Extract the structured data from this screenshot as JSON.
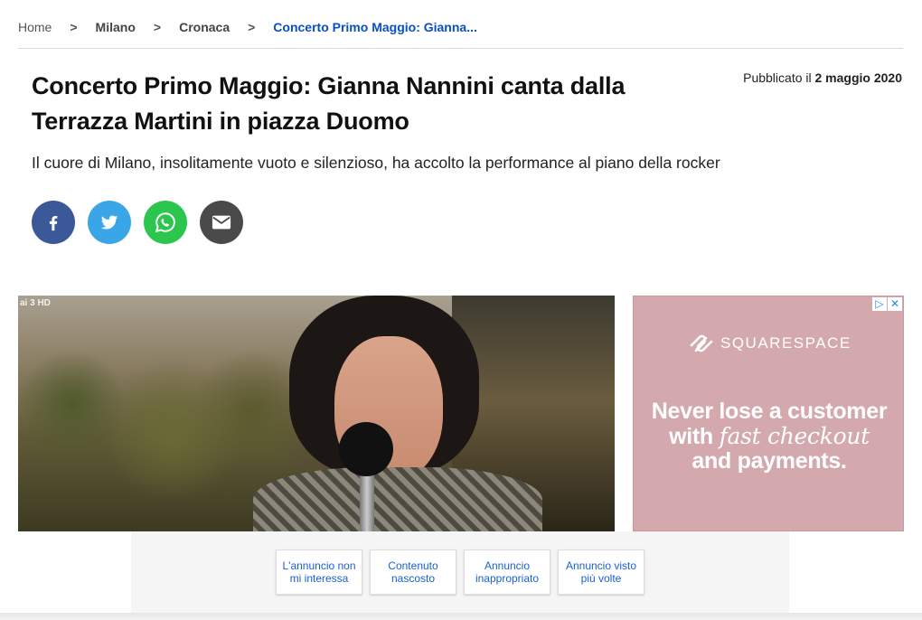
{
  "breadcrumb": {
    "items": [
      "Home",
      "Milano",
      "Cronaca",
      "Concerto Primo Maggio: Gianna..."
    ],
    "separator": ">"
  },
  "article": {
    "title": "Concerto Primo Maggio: Gianna Nannini canta dalla Terrazza Martini in piazza Duomo",
    "published_label": "Pubblicato il",
    "published_date": "2 maggio 2020",
    "summary": "Il cuore di Milano, insolitamente vuoto e silenzioso, ha accolto la performance al piano della rocker"
  },
  "share": {
    "icons": [
      "facebook-icon",
      "twitter-icon",
      "whatsapp-icon",
      "email-icon"
    ],
    "colors": {
      "facebook": "#3b5998",
      "twitter": "#3aa6e8",
      "whatsapp": "#2cc64f",
      "email": "#4a4a4a"
    }
  },
  "photo": {
    "channel_logo": "ai 3 HD"
  },
  "ad": {
    "brand": "SQUARESPACE",
    "headline_line1": "Never lose a customer",
    "headline_with": "with",
    "headline_italic": "fast checkout",
    "headline_line3": "and payments.",
    "choices": [
      "▷",
      "✕"
    ],
    "background": "#d4a9ae"
  },
  "ad_feedback": {
    "options": [
      "L'annuncio non mi interessa",
      "Contenuto nascosto",
      "Annuncio inappropriato",
      "Annuncio visto più volte"
    ]
  },
  "colors": {
    "accent": "#0a4fc2"
  }
}
